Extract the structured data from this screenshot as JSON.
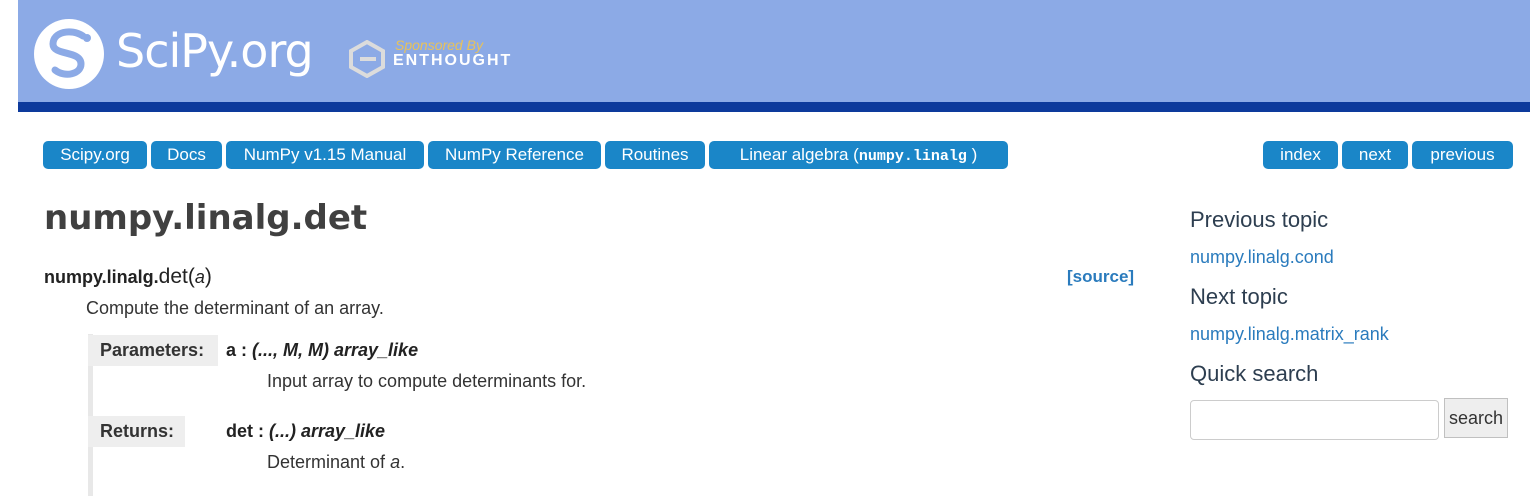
{
  "header": {
    "logo_text": "SciPy.org",
    "sponsor_top": "Sponsored By",
    "sponsor_name": "ENTHOUGHT"
  },
  "breadcrumbs": [
    {
      "label": "Scipy.org"
    },
    {
      "label": "Docs"
    },
    {
      "label": "NumPy v1.15 Manual"
    },
    {
      "label": "NumPy Reference"
    },
    {
      "label": "Routines"
    },
    {
      "label": "Linear algebra (",
      "code": "numpy.linalg",
      "suffix": " )"
    }
  ],
  "relnav": {
    "index": "index",
    "next": "next",
    "previous": "previous"
  },
  "main": {
    "title": "numpy.linalg.det",
    "sig_module": "numpy.linalg.",
    "sig_func": "det(",
    "sig_arg": "a",
    "sig_close": ")",
    "source_link": "[source]",
    "description": "Compute the determinant of an array.",
    "parameters_label": "Parameters:",
    "param_name": "a : ",
    "param_type": "(..., M, M) array_like",
    "param_desc": "Input array to compute determinants for.",
    "returns_label": "Returns:",
    "return_name": "det : ",
    "return_type": "(...) array_like",
    "return_desc_prefix": "Determinant of ",
    "return_desc_arg": "a",
    "return_desc_suffix": "."
  },
  "sidebar": {
    "previous_heading": "Previous topic",
    "previous_link": "numpy.linalg.cond",
    "next_heading": "Next topic",
    "next_link": "numpy.linalg.matrix_rank",
    "search_heading": "Quick search",
    "search_value": "",
    "search_button": "search"
  },
  "colors": {
    "header": "#8caae6",
    "header_bar": "#0d3a9c",
    "button": "#1a86c8",
    "link": "#2a7bbd"
  }
}
